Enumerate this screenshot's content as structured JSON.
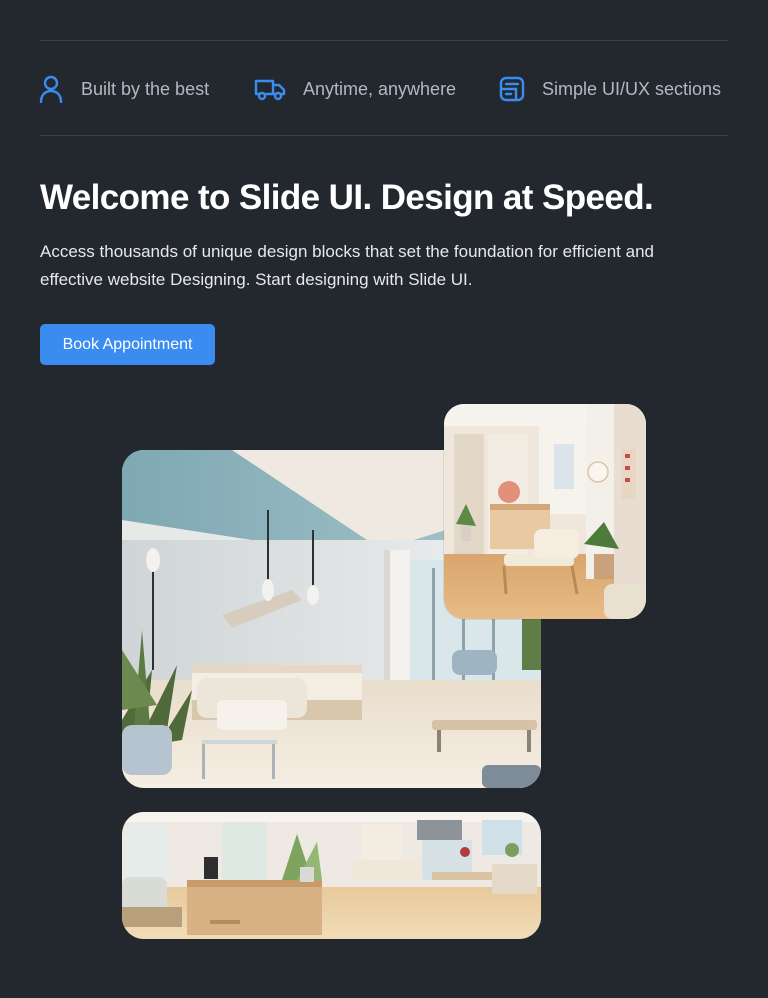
{
  "features": [
    {
      "icon": "user-icon",
      "label": "Built by the best"
    },
    {
      "icon": "truck-icon",
      "label": "Anytime, anywhere"
    },
    {
      "icon": "layout-icon",
      "label": "Simple UI/UX sections"
    }
  ],
  "hero": {
    "title": "Welcome to Slide UI. Design at Speed.",
    "description": "Access thousands of unique design blocks that set the foundation for efficient and effective website Designing. Start designing with Slide UI.",
    "cta_label": "Book Appointment"
  },
  "colors": {
    "background": "#23282f",
    "accent": "#3b8cf0",
    "divider": "#3a4048"
  }
}
